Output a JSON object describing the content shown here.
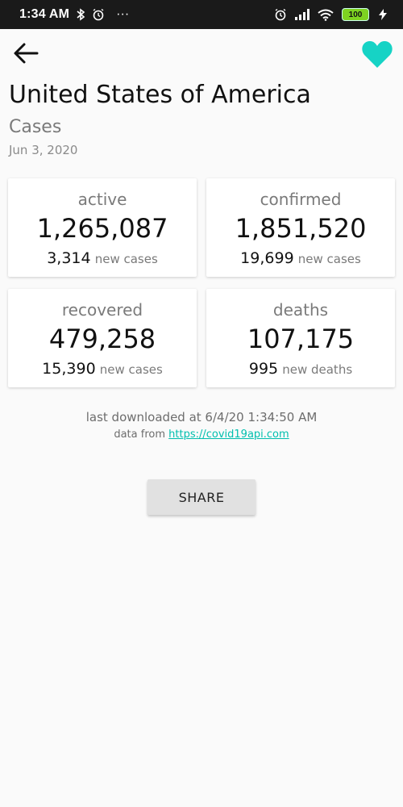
{
  "status_bar": {
    "time": "1:34 AM",
    "left_icons": [
      "bluetooth-icon",
      "alarm-icon",
      "more-dots-icon"
    ],
    "dots": "···",
    "right_icons": [
      "alarm-icon",
      "signal-icon",
      "wifi-icon",
      "battery-icon",
      "charging-icon"
    ],
    "battery": "100"
  },
  "header": {
    "back_icon": "arrow-back-icon",
    "favorite_icon": "heart-icon",
    "favorite_color": "#16d3c5"
  },
  "country": "United States of America",
  "section": "Cases",
  "date": "Jun 3, 2020",
  "cards": [
    {
      "label": "active",
      "value": "1,265,087",
      "new_count": "3,314",
      "new_label": "new cases"
    },
    {
      "label": "confirmed",
      "value": "1,851,520",
      "new_count": "19,699",
      "new_label": "new cases"
    },
    {
      "label": "recovered",
      "value": "479,258",
      "new_count": "15,390",
      "new_label": "new cases"
    },
    {
      "label": "deaths",
      "value": "107,175",
      "new_count": "995",
      "new_label": "new deaths"
    }
  ],
  "footer": {
    "downloaded": "last downloaded at 6/4/20 1:34:50 AM",
    "source_prefix": "data from",
    "source_link": "https://covid19api.com",
    "link_color": "#00bfae"
  },
  "share_label": "SHARE"
}
